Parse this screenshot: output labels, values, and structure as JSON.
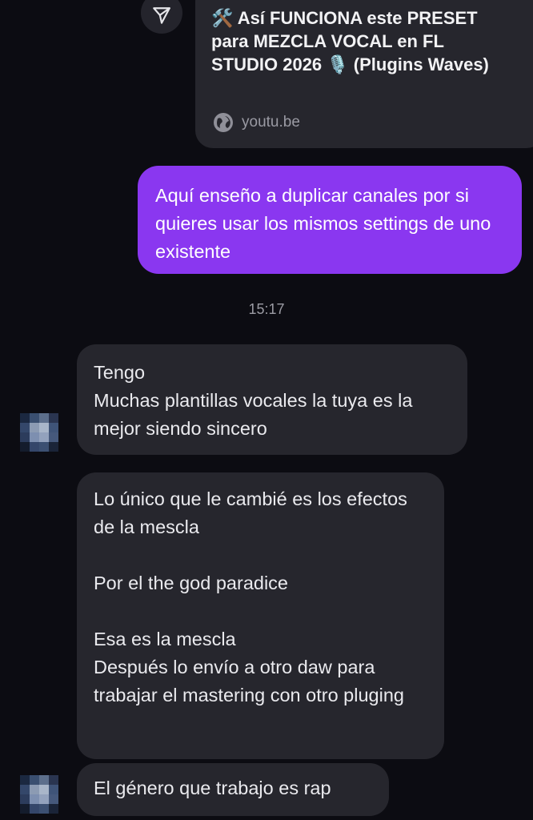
{
  "shared_link": {
    "title": "🛠️ Así FUNCIONA este PRESET para MEZCLA VOCAL en FL STUDIO 2026 🎙️ (Plugins Waves)",
    "domain": "youtu.be",
    "share_icon": "send-arrow-icon",
    "domain_icon": "globe-icon"
  },
  "messages": {
    "outgoing_1": "Aquí enseño a duplicar canales por si quieres usar los mismos settings de uno existente",
    "timestamp": "15:17",
    "incoming_1": "Tengo\nMuchas plantillas vocales la tuya es la mejor siendo sincero",
    "incoming_2": "Lo único que le cambié es los efectos de la mescla\n\nPor el  the god paradice\n\nEsa es la mescla\nDespués lo envío a otro daw para trabajar el mastering  con otro pluging",
    "incoming_3": "El género que trabajo es rap"
  },
  "colors": {
    "background": "#0c0c12",
    "incoming_bubble": "#26262d",
    "outgoing_bubble": "#8a37f0",
    "timestamp": "#9b9ba3"
  }
}
